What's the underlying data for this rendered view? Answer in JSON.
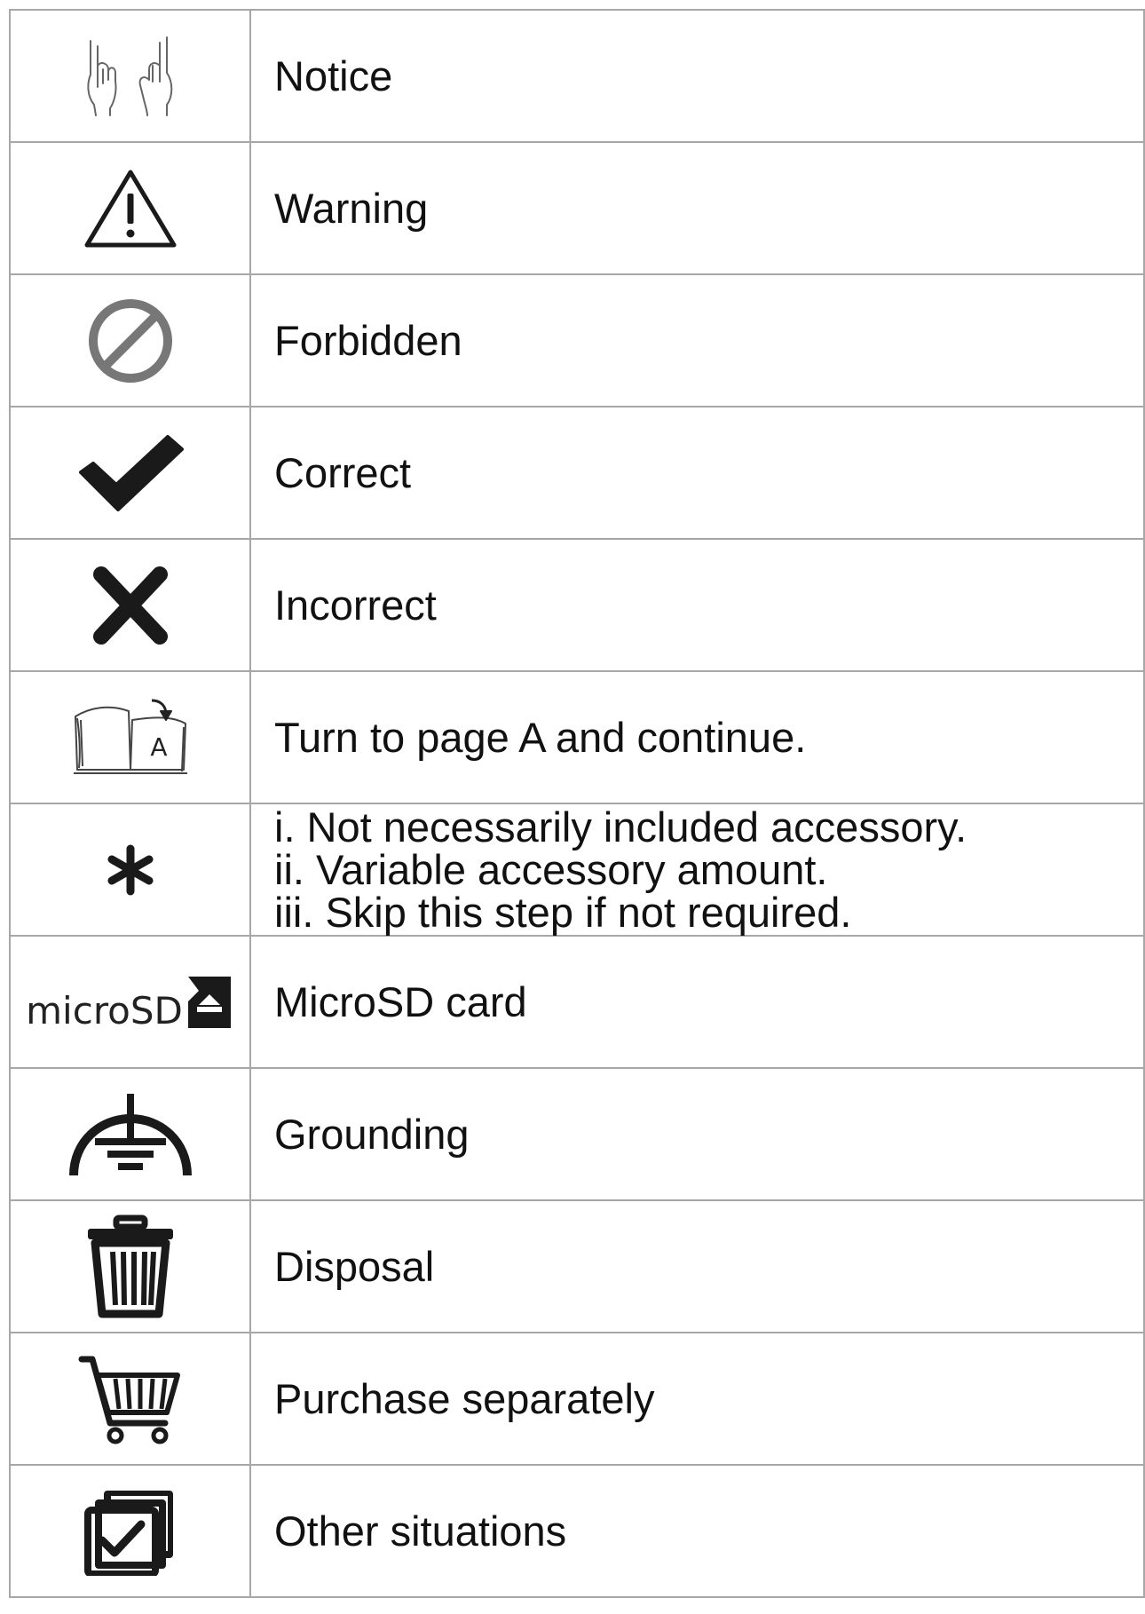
{
  "rows": [
    {
      "icon": "hands-pointing-icon",
      "label": "Notice"
    },
    {
      "icon": "warning-triangle-icon",
      "label": "Warning"
    },
    {
      "icon": "prohibited-circle-icon",
      "label": "Forbidden"
    },
    {
      "icon": "checkmark-icon",
      "label": "Correct"
    },
    {
      "icon": "cross-x-icon",
      "label": "Incorrect"
    },
    {
      "icon": "open-book-page-a-icon",
      "icon_text": "A",
      "label": "Turn to page A and continue."
    },
    {
      "icon": "asterisk-icon",
      "lines": [
        "i. Not necessarily included accessory.",
        "ii. Variable accessory amount.",
        "iii. Skip this step if not required."
      ]
    },
    {
      "icon": "microsd-card-icon",
      "icon_text": "microSD",
      "label": "MicroSD card"
    },
    {
      "icon": "grounding-icon",
      "label": "Grounding"
    },
    {
      "icon": "trash-bin-icon",
      "label": "Disposal"
    },
    {
      "icon": "shopping-cart-icon",
      "label": "Purchase separately"
    },
    {
      "icon": "stacked-checkbox-icon",
      "label": "Other situations"
    }
  ],
  "colors": {
    "grid_line": "#a7a7a7",
    "icon_dark": "#1a1a1a",
    "icon_gray": "#7a7a7a"
  }
}
